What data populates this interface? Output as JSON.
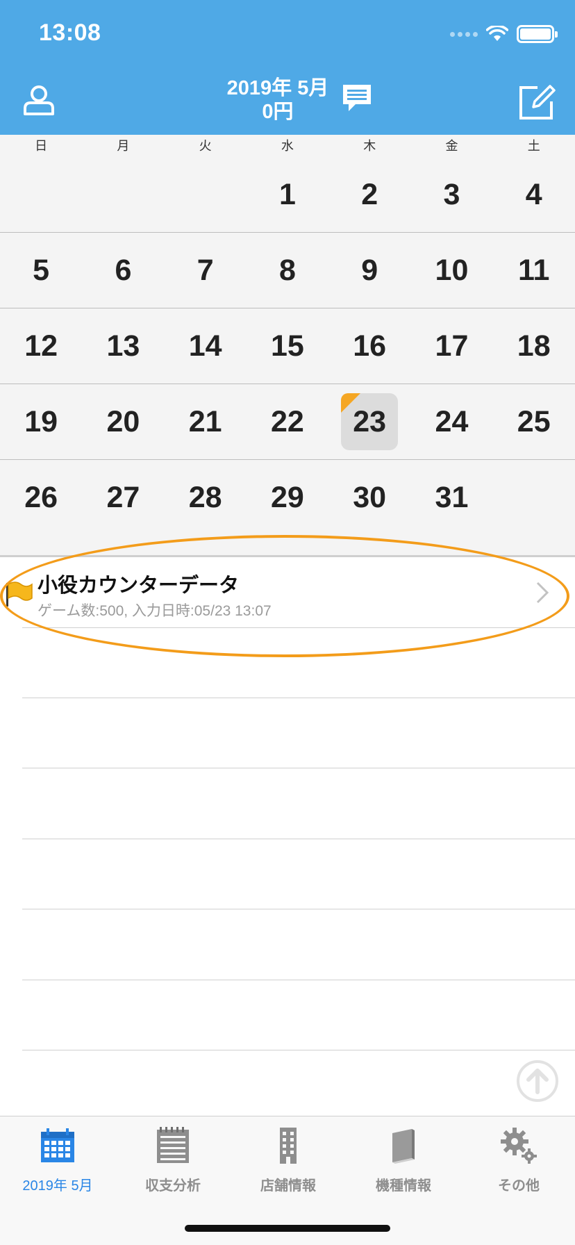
{
  "status_bar": {
    "time": "13:08"
  },
  "header": {
    "month_title": "2019年 5月",
    "amount": "0円",
    "icons": {
      "user": "user-icon",
      "chat": "chat-icon",
      "edit": "edit-icon"
    }
  },
  "calendar": {
    "weekdays": [
      "日",
      "月",
      "火",
      "水",
      "木",
      "金",
      "土"
    ],
    "weeks": [
      [
        "",
        "",
        "",
        "1",
        "2",
        "3",
        "4"
      ],
      [
        "5",
        "6",
        "7",
        "8",
        "9",
        "10",
        "11"
      ],
      [
        "12",
        "13",
        "14",
        "15",
        "16",
        "17",
        "18"
      ],
      [
        "19",
        "20",
        "21",
        "22",
        "23",
        "24",
        "25"
      ],
      [
        "26",
        "27",
        "28",
        "29",
        "30",
        "31",
        ""
      ]
    ],
    "today": "23",
    "today_marker_color": "#f5a623"
  },
  "list": {
    "items": [
      {
        "title": "小役カウンターデータ",
        "subtitle": "ゲーム数:500, 入力日時:05/23 13:07",
        "icon": "flag-icon"
      }
    ]
  },
  "tabbar": {
    "tabs": [
      {
        "label": "2019年 5月",
        "icon": "calendar-icon",
        "active": true
      },
      {
        "label": "収支分析",
        "icon": "notepad-icon",
        "active": false
      },
      {
        "label": "店舗情報",
        "icon": "building-icon",
        "active": false
      },
      {
        "label": "機種情報",
        "icon": "book-icon",
        "active": false
      },
      {
        "label": "その他",
        "icon": "gear-icon",
        "active": false
      }
    ]
  },
  "colors": {
    "header": "#4fa9e6",
    "active_tab": "#2a86e6",
    "highlight": "#f39c1a"
  }
}
